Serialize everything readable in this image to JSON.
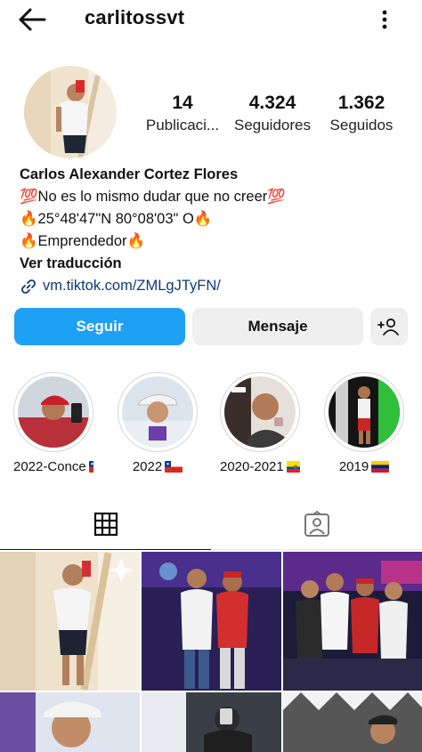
{
  "header": {
    "username": "carlitossvt",
    "back_icon": "arrow-left-icon",
    "more_icon": "more-vertical-icon"
  },
  "stats": {
    "posts_value": "14",
    "posts_label": "Publicaci...",
    "followers_value": "4.324",
    "followers_label": "Seguidores",
    "following_value": "1.362",
    "following_label": "Seguidos"
  },
  "bio": {
    "full_name": "Carlos Alexander Cortez Flores",
    "line1": "💯No es lo mismo dudar que no creer💯",
    "line2": "🔥25°48'47\"N 80°08'03\" O🔥",
    "line3": "🔥Emprendedor🔥",
    "translate": "Ver traducción",
    "link": "vm.tiktok.com/ZMLgJTyFN/"
  },
  "actions": {
    "follow_label": "Seguir",
    "message_label": "Mensaje",
    "add_user_icon": "person-add-icon"
  },
  "highlights": [
    {
      "label": "2022-Conce",
      "flag": "chile"
    },
    {
      "label": "2022",
      "flag": "chile"
    },
    {
      "label": "2020-2021",
      "flag": "ecuador"
    },
    {
      "label": "2019",
      "flag": "venezuela"
    }
  ],
  "tabs": [
    {
      "name": "posts-grid",
      "icon": "grid-icon",
      "active": true
    },
    {
      "name": "tagged",
      "icon": "tagged-person-icon",
      "active": false
    }
  ],
  "colors": {
    "follow_button": "#1ea0f5",
    "secondary_button": "#efefef",
    "link": "#0b3a75"
  }
}
